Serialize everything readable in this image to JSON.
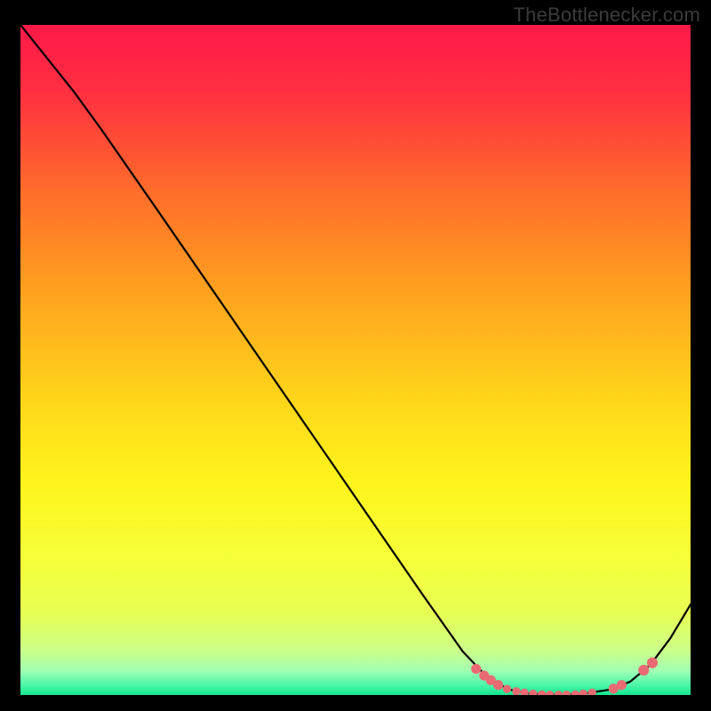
{
  "attribution": "TheBottlenecker.com",
  "chart_data": {
    "type": "line",
    "title": "",
    "xlabel": "",
    "ylabel": "",
    "xlim": [
      0,
      100
    ],
    "ylim": [
      0,
      100
    ],
    "background_gradient": {
      "stops": [
        {
          "offset": 0.0,
          "color": "#ff1a49"
        },
        {
          "offset": 0.1,
          "color": "#ff2f41"
        },
        {
          "offset": 0.25,
          "color": "#ff6d2b"
        },
        {
          "offset": 0.4,
          "color": "#ffa21f"
        },
        {
          "offset": 0.55,
          "color": "#ffd31a"
        },
        {
          "offset": 0.68,
          "color": "#fff41c"
        },
        {
          "offset": 0.8,
          "color": "#f5ff3a"
        },
        {
          "offset": 0.88,
          "color": "#e6ff55"
        },
        {
          "offset": 0.935,
          "color": "#caff8a"
        },
        {
          "offset": 0.965,
          "color": "#9effb4"
        },
        {
          "offset": 0.985,
          "color": "#4cf7a9"
        },
        {
          "offset": 1.0,
          "color": "#14e58e"
        }
      ]
    },
    "series": [
      {
        "name": "curve",
        "points": [
          {
            "x": 0.0,
            "y": 100.0
          },
          {
            "x": 4.0,
            "y": 95.0
          },
          {
            "x": 8.0,
            "y": 90.0
          },
          {
            "x": 12.0,
            "y": 84.5
          },
          {
            "x": 20.0,
            "y": 73.0
          },
          {
            "x": 30.0,
            "y": 58.5
          },
          {
            "x": 40.0,
            "y": 44.0
          },
          {
            "x": 50.0,
            "y": 29.5
          },
          {
            "x": 60.0,
            "y": 15.0
          },
          {
            "x": 66.0,
            "y": 6.5
          },
          {
            "x": 70.0,
            "y": 2.3
          },
          {
            "x": 73.0,
            "y": 0.8
          },
          {
            "x": 76.0,
            "y": 0.2
          },
          {
            "x": 80.0,
            "y": 0.0
          },
          {
            "x": 84.0,
            "y": 0.2
          },
          {
            "x": 88.0,
            "y": 0.8
          },
          {
            "x": 91.0,
            "y": 2.0
          },
          {
            "x": 94.0,
            "y": 4.5
          },
          {
            "x": 97.0,
            "y": 8.5
          },
          {
            "x": 100.0,
            "y": 13.5
          }
        ]
      }
    ],
    "markers": [
      {
        "x": 68.0,
        "y": 3.9,
        "r": 1.2
      },
      {
        "x": 69.2,
        "y": 2.9,
        "r": 1.2
      },
      {
        "x": 70.2,
        "y": 2.2,
        "r": 1.2
      },
      {
        "x": 71.3,
        "y": 1.5,
        "r": 1.2
      },
      {
        "x": 72.6,
        "y": 0.9,
        "r": 1.0
      },
      {
        "x": 74.0,
        "y": 0.55,
        "r": 1.0
      },
      {
        "x": 75.2,
        "y": 0.35,
        "r": 1.0
      },
      {
        "x": 76.5,
        "y": 0.2,
        "r": 1.0
      },
      {
        "x": 77.8,
        "y": 0.1,
        "r": 1.0
      },
      {
        "x": 79.0,
        "y": 0.05,
        "r": 1.0
      },
      {
        "x": 80.3,
        "y": 0.02,
        "r": 1.0
      },
      {
        "x": 81.5,
        "y": 0.05,
        "r": 1.0
      },
      {
        "x": 82.8,
        "y": 0.1,
        "r": 1.0
      },
      {
        "x": 84.0,
        "y": 0.2,
        "r": 1.0
      },
      {
        "x": 85.3,
        "y": 0.35,
        "r": 1.0
      },
      {
        "x": 88.5,
        "y": 0.95,
        "r": 1.2
      },
      {
        "x": 89.7,
        "y": 1.5,
        "r": 1.2
      },
      {
        "x": 93.0,
        "y": 3.7,
        "r": 1.3
      },
      {
        "x": 94.3,
        "y": 4.8,
        "r": 1.3
      }
    ]
  }
}
